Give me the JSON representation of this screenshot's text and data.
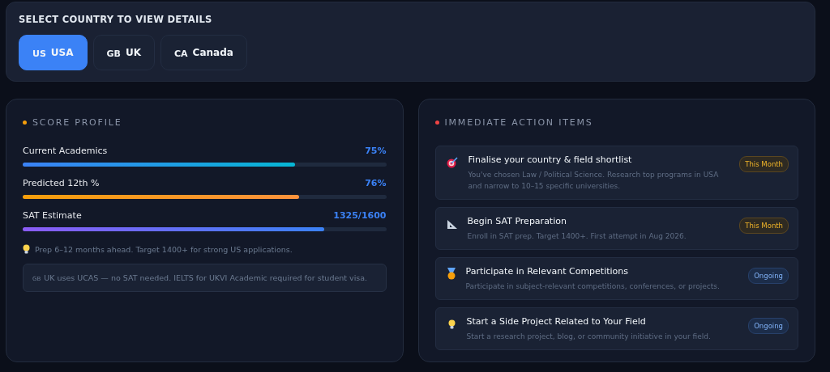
{
  "country_selector": {
    "title": "SELECT COUNTRY TO VIEW DETAILS",
    "countries": [
      {
        "code": "US",
        "label": "USA",
        "selected": true
      },
      {
        "code": "GB",
        "label": "UK",
        "selected": false
      },
      {
        "code": "CA",
        "label": "Canada",
        "selected": false
      }
    ]
  },
  "score_profile": {
    "title": "SCORE PROFILE",
    "metrics": [
      {
        "label": "Current Academics",
        "reading": "75%",
        "level": 0.75,
        "kind": "academics"
      },
      {
        "label": "Predicted 12th %",
        "reading": "76%",
        "level": 0.76,
        "kind": "predicted"
      },
      {
        "label": "SAT Estimate",
        "reading": "1325/1600",
        "level": 0.83,
        "kind": "sat"
      }
    ],
    "tip": "Prep 6–12 months ahead. Target 1400+ for strong US applications.",
    "note": {
      "code": "GB",
      "text": "UK uses UCAS — no SAT needed. IELTS for UKVI Academic required for student visa."
    }
  },
  "action_items": {
    "title": "IMMEDIATE ACTION ITEMS",
    "items": [
      {
        "title": "Finalise your country & field shortlist",
        "description": "You've chosen Law / Political Science. Research top programs in USA and narrow to 10–15 specific universities.",
        "badge": "This Month",
        "kind": "month"
      },
      {
        "title": "Begin SAT Preparation",
        "description": "Enroll in SAT prep. Target 1400+. First attempt in Aug 2026.",
        "badge": "This Month",
        "kind": "month"
      },
      {
        "title": "Participate in Relevant Competitions",
        "description": "Participate in subject-relevant competitions, conferences, or projects.",
        "badge": "Ongoing",
        "kind": "ongoing"
      },
      {
        "title": "Start a Side Project Related to Your Field",
        "description": "Start a research project, blog, or community initiative in your field.",
        "badge": "Ongoing",
        "kind": "ongoing"
      }
    ]
  }
}
